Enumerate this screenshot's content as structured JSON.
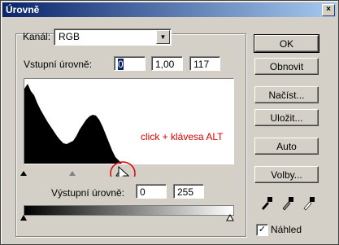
{
  "window": {
    "title": "Úrovně",
    "close_glyph": "×"
  },
  "channel": {
    "label": "Kanál:",
    "value": "RGB"
  },
  "input_levels": {
    "label": "Vstupní úrovně:",
    "black": "0",
    "gamma": "1,00",
    "white": "117"
  },
  "output_levels": {
    "label": "Výstupní úrovně:",
    "black": "0",
    "white": "255"
  },
  "buttons": {
    "ok": "OK",
    "reset": "Obnovit",
    "load": "Načíst...",
    "save": "Uložit...",
    "auto": "Auto",
    "options": "Volby..."
  },
  "preview": {
    "label": "Náhled",
    "checked": true,
    "mark": "✓"
  },
  "annotation": {
    "text": "click + klávesa ALT",
    "color": "#e00000"
  },
  "eyedroppers": [
    "black-eyedropper-icon",
    "gray-eyedropper-icon",
    "white-eyedropper-icon"
  ],
  "colors": {
    "titlebar_start": "#0a246a",
    "titlebar_end": "#a6caf0",
    "dialog_bg": "#d4d0c8"
  }
}
